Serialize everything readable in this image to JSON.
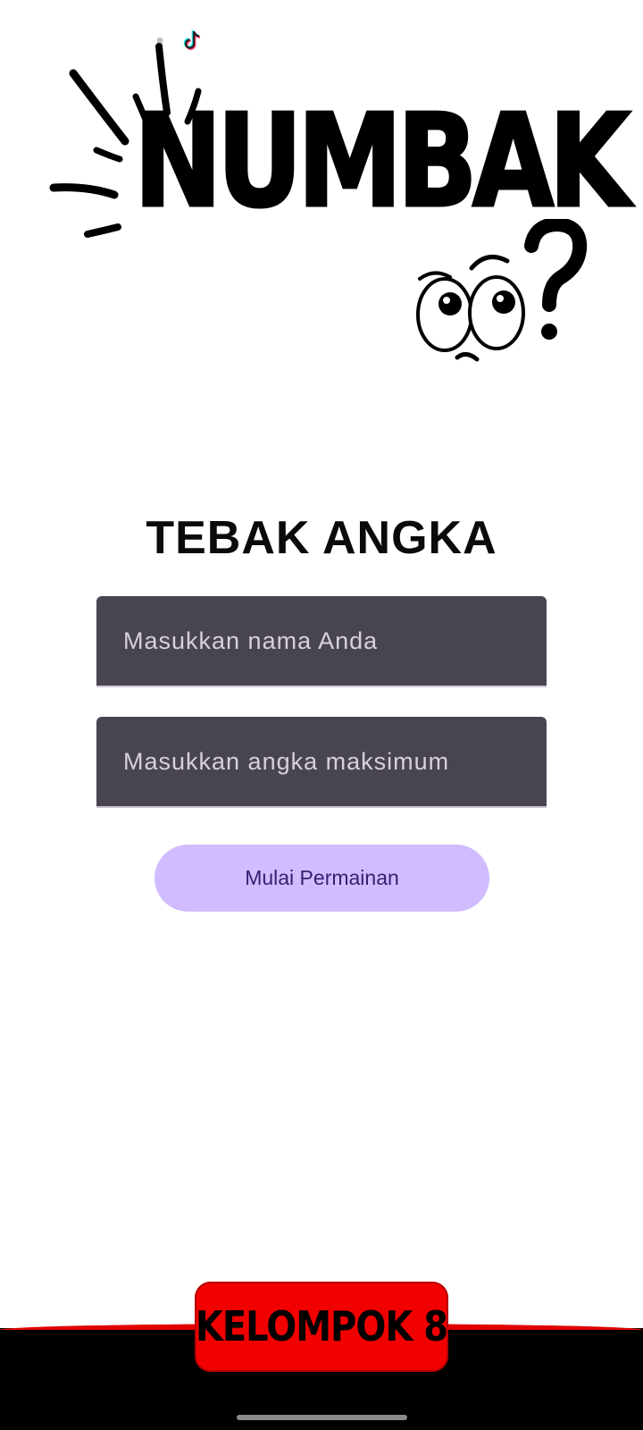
{
  "status_bar": {
    "app_icon": "tiktok-icon"
  },
  "logo": {
    "text": "NUMBAK",
    "decoration_icon": "confused-eyes-icon",
    "question_icon": "question-mark-icon"
  },
  "title": "TEBAK ANGKA",
  "form": {
    "name_placeholder": "Masukkan nama Anda",
    "max_placeholder": "Masukkan angka maksimum",
    "start_label": "Mulai Permainan"
  },
  "footer": {
    "badge_text": "KELOMPOK 8"
  },
  "colors": {
    "field_bg": "#49454f",
    "button_bg": "#d0bcff",
    "button_text": "#381e72",
    "badge_red": "#f20000",
    "footer_black": "#000000"
  }
}
